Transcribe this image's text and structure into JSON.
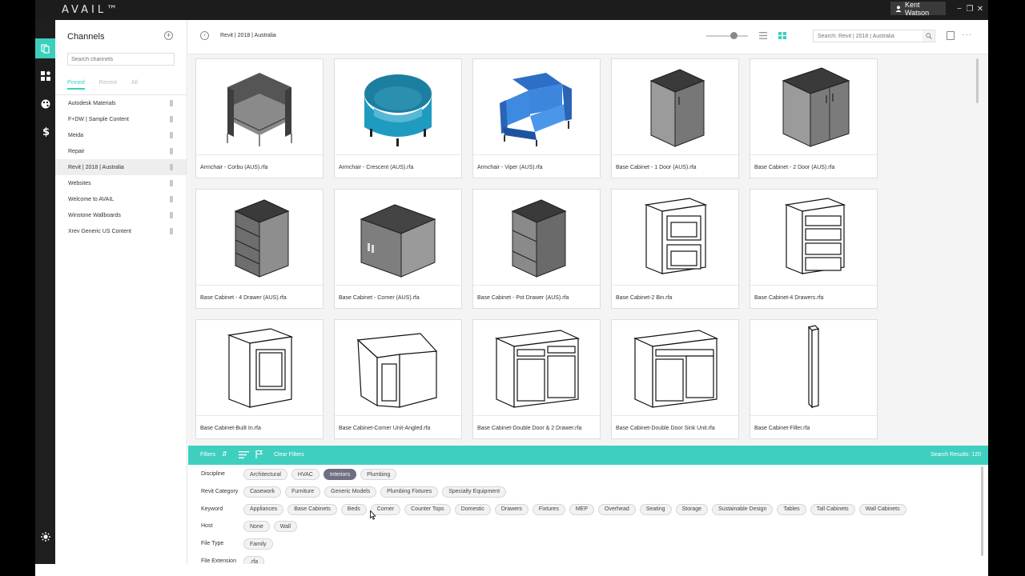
{
  "app": {
    "logo": "AVAIL™",
    "user_name": "Kent Watson"
  },
  "window_controls": {
    "minimize": "−",
    "restore": "❐",
    "close": "✕"
  },
  "rail": {
    "icons": [
      "channels-icon",
      "grid-module-icon",
      "palette-icon",
      "dollar-icon",
      "settings-sun-icon"
    ]
  },
  "channels": {
    "title": "Channels",
    "search_placeholder": "Search channels",
    "tabs": [
      "Pinned",
      "Recent",
      "All"
    ],
    "items": [
      "Autodesk Materials",
      "F+DW | Sample Content",
      "Meida",
      "Repair",
      "Revit | 2018 | Australia",
      "Websites",
      "Welcome to AVAIL",
      "Winstone Wallboards",
      "Xrev Generic US Content"
    ],
    "selected": "Revit | 2018 | Australia"
  },
  "topbar": {
    "breadcrumb": "Revit | 2018 | Australia",
    "search_placeholder": "Search: Revit | 2018 | Australia",
    "zoom_level": 0.6
  },
  "grid": {
    "cards": [
      {
        "label": "Armchair - Corbu (AUS).rfa",
        "icon": "armchair-corbu-icon"
      },
      {
        "label": "Armchair - Crescent (AUS).rfa",
        "icon": "armchair-crescent-icon"
      },
      {
        "label": "Armchair - Viper (AUS).rfa",
        "icon": "armchair-viper-icon"
      },
      {
        "label": "Base Cabinet - 1 Door (AUS).rfa",
        "icon": "cabinet-1-door-icon"
      },
      {
        "label": "Base Cabinet - 2 Door (AUS).rfa",
        "icon": "cabinet-2-door-icon"
      },
      {
        "label": "Base Cabinet - 4 Drawer (AUS).rfa",
        "icon": "cabinet-4-drawer-icon"
      },
      {
        "label": "Base Cabinet - Corner (AUS).rfa",
        "icon": "cabinet-corner-icon"
      },
      {
        "label": "Base Cabinet - Pot Drawer (AUS).rfa",
        "icon": "cabinet-pot-drawer-icon"
      },
      {
        "label": "Base Cabinet-2 Bin.rfa",
        "icon": "cabinet-2-bin-icon"
      },
      {
        "label": "Base Cabinet-4 Drawers.rfa",
        "icon": "cabinet-4-drawers-icon"
      },
      {
        "label": "Base Cabinet-Built In.rfa",
        "icon": "cabinet-built-in-icon"
      },
      {
        "label": "Base Cabinet-Corner Unit-Angled.rfa",
        "icon": "cabinet-corner-angled-icon"
      },
      {
        "label": "Base Cabinet-Double Door & 2 Drawer.rfa",
        "icon": "cabinet-double-door-drawer-icon"
      },
      {
        "label": "Base Cabinet-Double Door Sink Unit.rfa",
        "icon": "cabinet-sink-unit-icon"
      },
      {
        "label": "Base Cabinet-Filler.rfa",
        "icon": "cabinet-filler-icon"
      }
    ]
  },
  "filterbar": {
    "filters_label": "Filters",
    "clear_label": "Clear Filters",
    "results": "Search Results: 120"
  },
  "filters": [
    {
      "label": "Discipline",
      "chips": [
        "Architectural",
        "HVAC",
        "Interiors",
        "Plumbing"
      ],
      "active": "Interiors"
    },
    {
      "label": "Revit Category",
      "chips": [
        "Casework",
        "Furniture",
        "Generic Models",
        "Plumbing Fixtures",
        "Specialty Equipment"
      ]
    },
    {
      "label": "Keyword",
      "chips": [
        "Appliances",
        "Base Cabinets",
        "Beds",
        "Corner",
        "Counter Tops",
        "Domestic",
        "Drawers",
        "Fixtures",
        "MEP",
        "Overhead",
        "Seating",
        "Storage",
        "Sustainable Design",
        "Tables",
        "Tall Cabinets",
        "Wall Cabinets"
      ]
    },
    {
      "label": "Host",
      "chips": [
        "None",
        "Wall"
      ]
    },
    {
      "label": "File Type",
      "chips": [
        "Family"
      ]
    },
    {
      "label": "File Extension",
      "chips": [
        ".rfa"
      ]
    }
  ]
}
